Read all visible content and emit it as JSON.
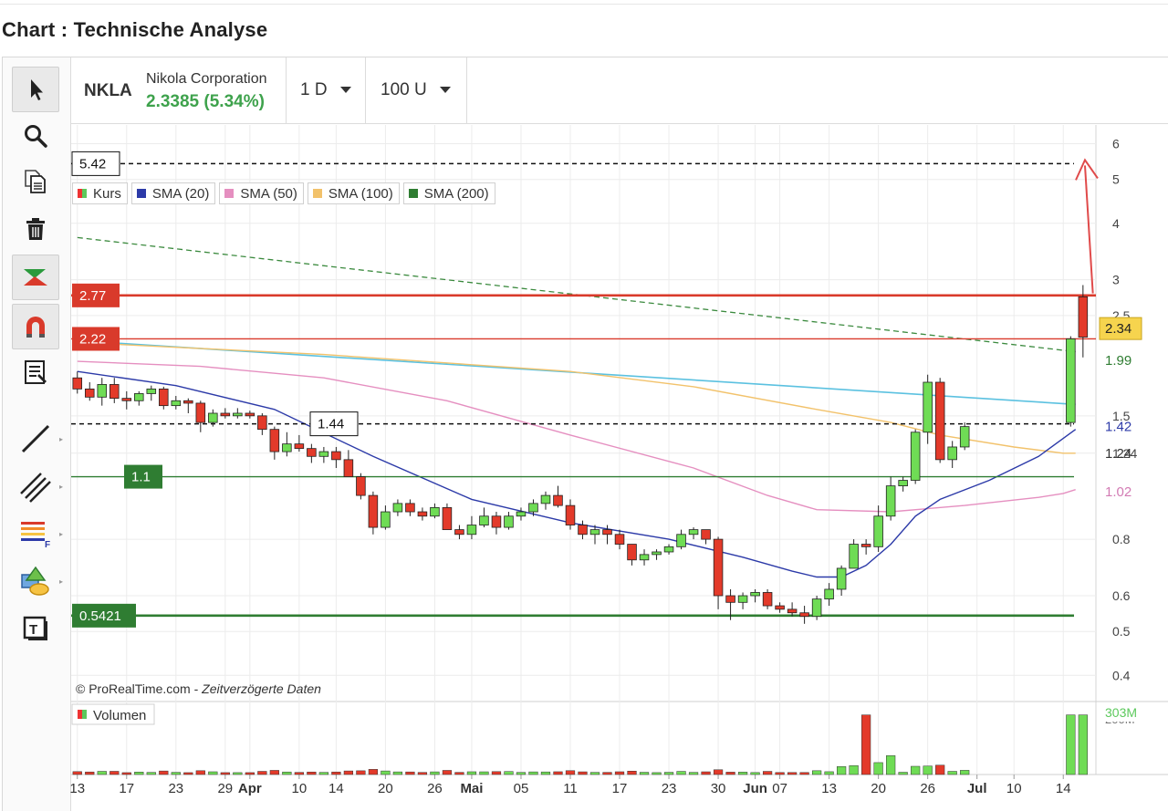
{
  "page": {
    "title": "Chart : Technische Analyse"
  },
  "instrument": {
    "symbol": "NKLA",
    "name": "Nikola Corporation",
    "price": "2.3385 (5.34%)"
  },
  "controls": {
    "interval": "1 D",
    "bars": "100 U"
  },
  "toolbar": {
    "tools": [
      "pointer-icon",
      "zoom-icon",
      "copy-icon",
      "trash-icon",
      "chart-style-icon",
      "magnet-icon",
      "list-icon",
      "line-tool-icon",
      "parallel-lines-icon",
      "fibonacci-icon",
      "shapes-icon",
      "text-tool-icon"
    ]
  },
  "legend": [
    {
      "label": "Kurs",
      "color": "#e33"
    },
    {
      "label": "SMA (20)",
      "color": "#2c3aa8"
    },
    {
      "label": "SMA (50)",
      "color": "#e58fc0"
    },
    {
      "label": "SMA (100)",
      "color": "#f2c26b"
    },
    {
      "label": "SMA (200)",
      "color": "#2f7d32"
    }
  ],
  "levels": [
    {
      "value": 5.42,
      "label": "5.42",
      "style": "dashed-black"
    },
    {
      "value": 2.77,
      "label": "2.77",
      "style": "red"
    },
    {
      "value": 2.22,
      "label": "2.22",
      "style": "red-thin"
    },
    {
      "value": 1.44,
      "label": "1.44",
      "style": "dashed-black"
    },
    {
      "value": 1.1,
      "label": "1.1",
      "style": "green"
    },
    {
      "value": 0.5421,
      "label": "0.5421",
      "style": "green"
    }
  ],
  "right_labels": [
    {
      "value": 2.34,
      "label": "2.34",
      "color": "#222",
      "bg": "#f6d44e"
    },
    {
      "value": 1.99,
      "label": "1.99",
      "color": "#2f7d32"
    },
    {
      "value": 1.42,
      "label": "1.42",
      "color": "#2c3aa8"
    },
    {
      "value": 1.24,
      "label": "1.24",
      "color": "#333"
    },
    {
      "value": 1.02,
      "label": "1.02",
      "color": "#d27ab3"
    }
  ],
  "credits": {
    "source": "© ProRealTime.com",
    "sep": " - ",
    "note": "Zeitverzögerte Daten"
  },
  "volume_panel": {
    "label": "Volumen",
    "max_label": "303M",
    "tick_label": "200M"
  },
  "chart_data": {
    "type": "candlestick",
    "y_scale": "log",
    "ylim": [
      0.35,
      6.6
    ],
    "y_ticks": [
      6,
      5,
      4,
      3,
      2.5,
      1.5,
      1.24,
      0.8,
      0.6,
      0.5,
      0.4
    ],
    "x_ticks": [
      {
        "i": 0,
        "label": "13"
      },
      {
        "i": 4,
        "label": "17"
      },
      {
        "i": 8,
        "label": "23"
      },
      {
        "i": 12,
        "label": "29"
      },
      {
        "i": 14,
        "label": "Apr",
        "bold": true
      },
      {
        "i": 18,
        "label": "10"
      },
      {
        "i": 21,
        "label": "14"
      },
      {
        "i": 25,
        "label": "20"
      },
      {
        "i": 29,
        "label": "26"
      },
      {
        "i": 32,
        "label": "Mai",
        "bold": true
      },
      {
        "i": 36,
        "label": "05"
      },
      {
        "i": 40,
        "label": "11"
      },
      {
        "i": 44,
        "label": "17"
      },
      {
        "i": 48,
        "label": "23"
      },
      {
        "i": 52,
        "label": "30"
      },
      {
        "i": 55,
        "label": "Jun",
        "bold": true
      },
      {
        "i": 57,
        "label": "07"
      },
      {
        "i": 61,
        "label": "13"
      },
      {
        "i": 65,
        "label": "20"
      },
      {
        "i": 69,
        "label": "26"
      },
      {
        "i": 73,
        "label": "Jul",
        "bold": true
      },
      {
        "i": 76,
        "label": "10"
      },
      {
        "i": 80,
        "label": "14"
      }
    ],
    "candles": [
      [
        1.82,
        1.88,
        1.68,
        1.72
      ],
      [
        1.72,
        1.78,
        1.62,
        1.65
      ],
      [
        1.65,
        1.82,
        1.58,
        1.76
      ],
      [
        1.76,
        1.82,
        1.6,
        1.64
      ],
      [
        1.64,
        1.7,
        1.55,
        1.62
      ],
      [
        1.62,
        1.7,
        1.58,
        1.68
      ],
      [
        1.68,
        1.75,
        1.62,
        1.72
      ],
      [
        1.72,
        1.74,
        1.55,
        1.58
      ],
      [
        1.58,
        1.66,
        1.55,
        1.62
      ],
      [
        1.62,
        1.64,
        1.52,
        1.6
      ],
      [
        1.6,
        1.62,
        1.38,
        1.45
      ],
      [
        1.45,
        1.55,
        1.42,
        1.52
      ],
      [
        1.52,
        1.56,
        1.48,
        1.5
      ],
      [
        1.5,
        1.56,
        1.48,
        1.52
      ],
      [
        1.52,
        1.54,
        1.48,
        1.5
      ],
      [
        1.5,
        1.52,
        1.36,
        1.4
      ],
      [
        1.4,
        1.42,
        1.2,
        1.25
      ],
      [
        1.25,
        1.38,
        1.22,
        1.3
      ],
      [
        1.3,
        1.36,
        1.25,
        1.27
      ],
      [
        1.27,
        1.3,
        1.18,
        1.22
      ],
      [
        1.22,
        1.28,
        1.18,
        1.25
      ],
      [
        1.25,
        1.28,
        1.15,
        1.2
      ],
      [
        1.2,
        1.26,
        1.1,
        1.1
      ],
      [
        1.1,
        1.12,
        0.98,
        1.0
      ],
      [
        1.0,
        1.02,
        0.82,
        0.85
      ],
      [
        0.85,
        0.95,
        0.84,
        0.92
      ],
      [
        0.92,
        0.98,
        0.9,
        0.96
      ],
      [
        0.96,
        0.98,
        0.9,
        0.92
      ],
      [
        0.92,
        0.94,
        0.88,
        0.9
      ],
      [
        0.9,
        0.96,
        0.89,
        0.94
      ],
      [
        0.94,
        0.96,
        0.84,
        0.84
      ],
      [
        0.84,
        0.86,
        0.8,
        0.82
      ],
      [
        0.82,
        0.9,
        0.8,
        0.86
      ],
      [
        0.86,
        0.94,
        0.85,
        0.9
      ],
      [
        0.9,
        0.92,
        0.82,
        0.85
      ],
      [
        0.85,
        0.92,
        0.84,
        0.9
      ],
      [
        0.9,
        0.94,
        0.88,
        0.92
      ],
      [
        0.92,
        0.98,
        0.9,
        0.96
      ],
      [
        0.96,
        1.02,
        0.93,
        1.0
      ],
      [
        1.0,
        1.05,
        0.94,
        0.95
      ],
      [
        0.95,
        0.98,
        0.84,
        0.86
      ],
      [
        0.86,
        0.88,
        0.8,
        0.82
      ],
      [
        0.82,
        0.86,
        0.78,
        0.84
      ],
      [
        0.84,
        0.86,
        0.78,
        0.82
      ],
      [
        0.82,
        0.84,
        0.76,
        0.78
      ],
      [
        0.78,
        0.78,
        0.7,
        0.72
      ],
      [
        0.72,
        0.76,
        0.7,
        0.74
      ],
      [
        0.74,
        0.76,
        0.72,
        0.75
      ],
      [
        0.75,
        0.78,
        0.74,
        0.77
      ],
      [
        0.77,
        0.84,
        0.76,
        0.82
      ],
      [
        0.82,
        0.85,
        0.8,
        0.84
      ],
      [
        0.84,
        0.84,
        0.78,
        0.8
      ],
      [
        0.8,
        0.81,
        0.56,
        0.6
      ],
      [
        0.6,
        0.62,
        0.53,
        0.58
      ],
      [
        0.58,
        0.61,
        0.56,
        0.6
      ],
      [
        0.6,
        0.62,
        0.58,
        0.61
      ],
      [
        0.61,
        0.62,
        0.56,
        0.57
      ],
      [
        0.57,
        0.58,
        0.55,
        0.56
      ],
      [
        0.56,
        0.58,
        0.54,
        0.55
      ],
      [
        0.55,
        0.57,
        0.52,
        0.54
      ],
      [
        0.54,
        0.6,
        0.53,
        0.59
      ],
      [
        0.59,
        0.64,
        0.57,
        0.62
      ],
      [
        0.62,
        0.7,
        0.6,
        0.69
      ],
      [
        0.69,
        0.8,
        0.69,
        0.78
      ],
      [
        0.78,
        0.8,
        0.74,
        0.77
      ],
      [
        0.77,
        0.95,
        0.75,
        0.9
      ],
      [
        0.9,
        1.1,
        0.88,
        1.05
      ],
      [
        1.05,
        1.1,
        1.02,
        1.08
      ],
      [
        1.08,
        1.4,
        1.06,
        1.38
      ],
      [
        1.38,
        1.85,
        1.3,
        1.78
      ],
      [
        1.78,
        1.82,
        1.18,
        1.2
      ],
      [
        1.2,
        1.32,
        1.15,
        1.28
      ],
      [
        1.28,
        1.45,
        1.26,
        1.42
      ]
    ],
    "sma20": [
      [
        0,
        1.88
      ],
      [
        8,
        1.75
      ],
      [
        16,
        1.55
      ],
      [
        24,
        1.22
      ],
      [
        32,
        0.98
      ],
      [
        40,
        0.87
      ],
      [
        48,
        0.8
      ],
      [
        54,
        0.73
      ],
      [
        58,
        0.68
      ],
      [
        60,
        0.66
      ],
      [
        62,
        0.66
      ],
      [
        64,
        0.7
      ],
      [
        66,
        0.78
      ],
      [
        68,
        0.9
      ],
      [
        70,
        0.98
      ],
      [
        74,
        1.08
      ],
      [
        78,
        1.22
      ],
      [
        81,
        1.4
      ]
    ],
    "sma50": [
      [
        0,
        1.98
      ],
      [
        10,
        1.93
      ],
      [
        20,
        1.82
      ],
      [
        30,
        1.62
      ],
      [
        40,
        1.36
      ],
      [
        50,
        1.15
      ],
      [
        56,
        1.0
      ],
      [
        60,
        0.93
      ],
      [
        66,
        0.92
      ],
      [
        72,
        0.95
      ],
      [
        78,
        0.99
      ],
      [
        80,
        1.01
      ],
      [
        81,
        1.03
      ]
    ],
    "sma100": [
      [
        0,
        2.18
      ],
      [
        20,
        2.05
      ],
      [
        40,
        1.88
      ],
      [
        50,
        1.74
      ],
      [
        60,
        1.55
      ],
      [
        66,
        1.45
      ],
      [
        70,
        1.36
      ],
      [
        76,
        1.28
      ],
      [
        80,
        1.24
      ],
      [
        81,
        1.24
      ]
    ],
    "trend_blue": [
      [
        0,
        2.2
      ],
      [
        81,
        1.59
      ]
    ],
    "trend_green_dashed": [
      [
        0,
        3.72
      ],
      [
        81,
        2.08
      ]
    ],
    "volume": []
  }
}
